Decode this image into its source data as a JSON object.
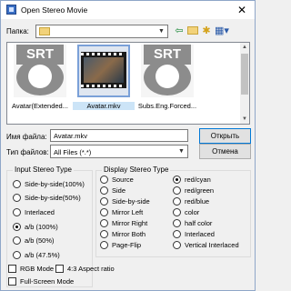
{
  "window": {
    "title": "Open Stereo Movie",
    "close_glyph": "✕"
  },
  "folder": {
    "label": "Папка:",
    "value": "",
    "icons": [
      "back-icon",
      "up-folder-icon",
      "new-folder-icon",
      "view-menu-icon"
    ]
  },
  "files": [
    {
      "name": "Avatar(Extended...",
      "type": "srt",
      "badge": "SRT",
      "selected": false
    },
    {
      "name": "Avatar.mkv",
      "type": "video",
      "selected": true
    },
    {
      "name": "Subs.Eng.Forced...",
      "type": "srt",
      "badge": "SRT",
      "selected": false
    }
  ],
  "filename": {
    "label": "Имя файла:",
    "value": "Avatar.mkv",
    "open_button": "Открыть"
  },
  "filetype": {
    "label": "Тип файлов:",
    "value": "All Files (*.*)",
    "cancel_button": "Отмена"
  },
  "input_type": {
    "title": "Input Stereo Type",
    "selected": 3,
    "options": [
      "Side-by-side(100%)",
      "Side-by-side(50%)",
      "Interlaced",
      "a/b (100%)",
      "a/b (50%)",
      "a/b (47.5%)"
    ]
  },
  "display_type": {
    "title": "Display Stereo Type",
    "col1": [
      "Source",
      "Side",
      "Side-by-side",
      "Mirror Left",
      "Mirror Right",
      "Mirror Both",
      "Page-Flip"
    ],
    "col2": [
      "red/cyan",
      "red/green",
      "red/blue",
      "color",
      "half color",
      "Interlaced",
      "Vertical Interlaced"
    ],
    "selected_col": 2,
    "selected_index": 0
  },
  "checkboxes": {
    "rgb_mode": "RGB Mode",
    "aspect": "4:3 Aspect ratio",
    "fullscreen": "Full-Screen Mode"
  }
}
